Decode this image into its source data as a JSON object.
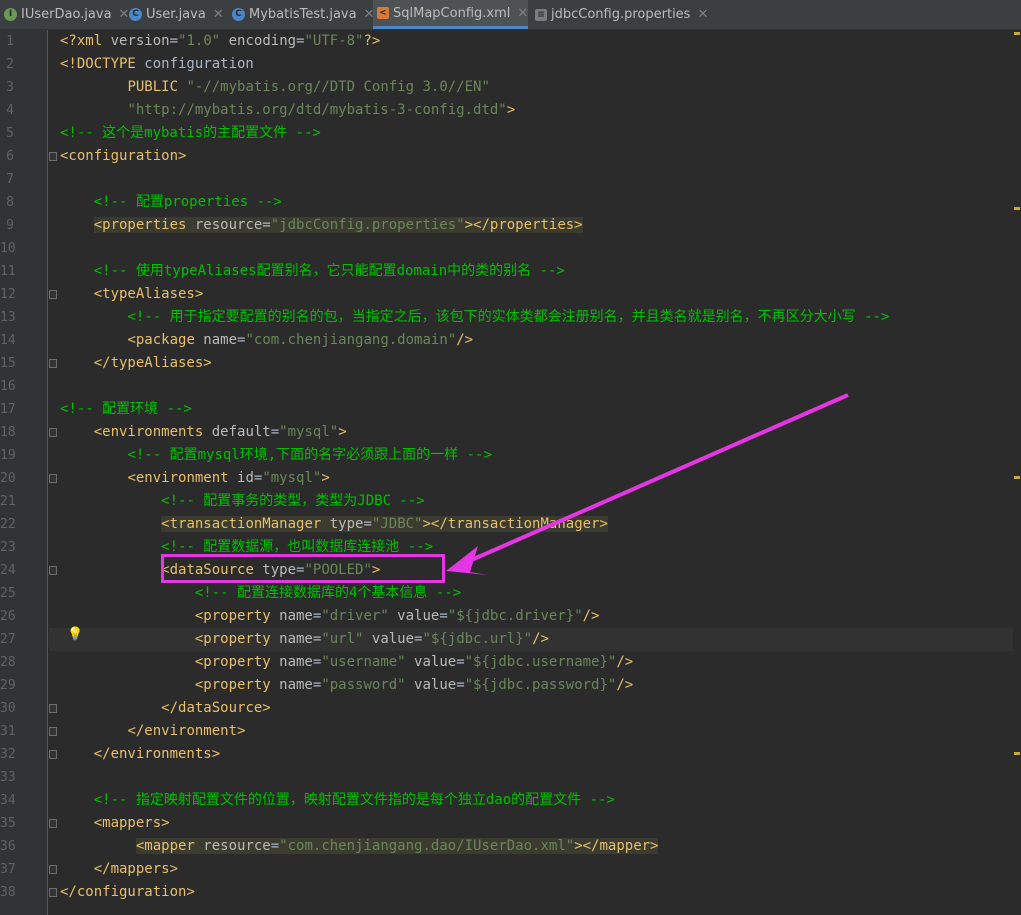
{
  "tabs": [
    {
      "icon": "interface-icon",
      "label": "IUserDao.java",
      "active": false
    },
    {
      "icon": "class-icon",
      "label": "User.java",
      "active": false
    },
    {
      "icon": "class-icon",
      "label": "MybatisTest.java",
      "active": false
    },
    {
      "icon": "xml-file-icon",
      "label": "SqlMapConfig.xml",
      "active": true
    },
    {
      "icon": "properties-file-icon",
      "label": "jdbcConfig.properties",
      "active": false
    }
  ],
  "lines": [
    {
      "n": "1",
      "tokens": [
        [
          "t",
          "<?xml"
        ],
        [
          "an",
          " version"
        ],
        [
          "df",
          "="
        ],
        [
          "av",
          "\"1.0\""
        ],
        [
          "an",
          " encoding"
        ],
        [
          "df",
          "="
        ],
        [
          "av",
          "\"UTF-8\""
        ],
        [
          "t",
          "?>"
        ]
      ]
    },
    {
      "n": "2",
      "tokens": [
        [
          "t",
          "<!DOCTYPE"
        ],
        [
          "df",
          " configuration"
        ]
      ]
    },
    {
      "n": "3",
      "tokens": [
        [
          "df",
          "        "
        ],
        [
          "t",
          "PUBLIC "
        ],
        [
          "av",
          "\"-//mybatis.org//DTD Config 3.0//EN\""
        ]
      ]
    },
    {
      "n": "4",
      "tokens": [
        [
          "df",
          "        "
        ],
        [
          "av",
          "\"http://mybatis.org/dtd/mybatis-3-config.dtd\""
        ],
        [
          "t",
          ">"
        ]
      ]
    },
    {
      "n": "5",
      "tokens": [
        [
          "cm",
          "<!-- 这个是mybatis的主配置文件 -->"
        ]
      ]
    },
    {
      "n": "6",
      "tokens": [
        [
          "t",
          "<configuration>"
        ]
      ]
    },
    {
      "n": "7",
      "tokens": []
    },
    {
      "n": "8",
      "tokens": [
        [
          "df",
          "    "
        ],
        [
          "cm",
          "<!-- 配置properties -->"
        ]
      ]
    },
    {
      "n": "9",
      "tokens": [
        [
          "df",
          "    "
        ],
        [
          "t hl",
          "<properties"
        ],
        [
          "an hl",
          " resource"
        ],
        [
          "df hl",
          "="
        ],
        [
          "av hl",
          "\"jdbcConfig.properties\""
        ],
        [
          "t hl",
          "></properties>"
        ]
      ]
    },
    {
      "n": "10",
      "tokens": []
    },
    {
      "n": "11",
      "tokens": [
        [
          "df",
          "    "
        ],
        [
          "cm",
          "<!-- 使用typeAliases配置别名，它只能配置domain中的类的别名 -->"
        ]
      ]
    },
    {
      "n": "12",
      "tokens": [
        [
          "df",
          "    "
        ],
        [
          "t",
          "<typeAliases>"
        ]
      ]
    },
    {
      "n": "13",
      "tokens": [
        [
          "df",
          "        "
        ],
        [
          "cm",
          "<!-- 用于指定要配置的别名的包，当指定之后，该包下的实体类都会注册别名，并且类名就是别名，不再区分大小写 -->"
        ]
      ]
    },
    {
      "n": "14",
      "tokens": [
        [
          "df",
          "        "
        ],
        [
          "t",
          "<package"
        ],
        [
          "an",
          " name"
        ],
        [
          "df",
          "="
        ],
        [
          "av",
          "\"com.chenjiangang.domain\""
        ],
        [
          "t",
          "/>"
        ]
      ]
    },
    {
      "n": "15",
      "tokens": [
        [
          "df",
          "    "
        ],
        [
          "t",
          "</typeAliases>"
        ]
      ]
    },
    {
      "n": "16",
      "tokens": []
    },
    {
      "n": "17",
      "tokens": [
        [
          "cm",
          "<!-- 配置环境 -->"
        ]
      ]
    },
    {
      "n": "18",
      "tokens": [
        [
          "df",
          "    "
        ],
        [
          "t",
          "<environments"
        ],
        [
          "an",
          " default"
        ],
        [
          "df",
          "="
        ],
        [
          "av",
          "\"mysql\""
        ],
        [
          "t",
          ">"
        ]
      ]
    },
    {
      "n": "19",
      "tokens": [
        [
          "df",
          "        "
        ],
        [
          "cm",
          "<!-- 配置mysql环境,下面的名字必须跟上面的一样 -->"
        ]
      ]
    },
    {
      "n": "20",
      "tokens": [
        [
          "df",
          "        "
        ],
        [
          "t",
          "<environment"
        ],
        [
          "an",
          " id"
        ],
        [
          "df",
          "="
        ],
        [
          "av",
          "\"mysql\""
        ],
        [
          "t",
          ">"
        ]
      ]
    },
    {
      "n": "21",
      "tokens": [
        [
          "df",
          "            "
        ],
        [
          "cm",
          "<!-- 配置事务的类型，类型为JDBC -->"
        ]
      ]
    },
    {
      "n": "22",
      "tokens": [
        [
          "df",
          "            "
        ],
        [
          "t hl",
          "<transactionManager"
        ],
        [
          "an hl",
          " type"
        ],
        [
          "df hl",
          "="
        ],
        [
          "av hl",
          "\"JDBC\""
        ],
        [
          "t hl",
          "></transactionManager>"
        ]
      ]
    },
    {
      "n": "23",
      "tokens": [
        [
          "df",
          "            "
        ],
        [
          "cm",
          "<!-- 配置数据源，也叫数据库连接池 -->"
        ]
      ]
    },
    {
      "n": "24",
      "tokens": [
        [
          "df",
          "            "
        ],
        [
          "t",
          "<dataSource"
        ],
        [
          "an",
          " type"
        ],
        [
          "df",
          "="
        ],
        [
          "av",
          "\"POOLED\""
        ],
        [
          "t",
          ">"
        ]
      ]
    },
    {
      "n": "25",
      "tokens": [
        [
          "df",
          "                "
        ],
        [
          "cm",
          "<!-- 配置连接数据库的4个基本信息 -->"
        ]
      ]
    },
    {
      "n": "26",
      "tokens": [
        [
          "df",
          "                "
        ],
        [
          "t",
          "<property"
        ],
        [
          "an",
          " name"
        ],
        [
          "df",
          "="
        ],
        [
          "av",
          "\"driver\""
        ],
        [
          "an",
          " value"
        ],
        [
          "df",
          "="
        ],
        [
          "av",
          "\"${jdbc.driver}\""
        ],
        [
          "t",
          "/>"
        ]
      ]
    },
    {
      "n": "27",
      "tokens": [
        [
          "df",
          "                "
        ],
        [
          "t",
          "<property"
        ],
        [
          "an",
          " name"
        ],
        [
          "df",
          "="
        ],
        [
          "av",
          "\"url\""
        ],
        [
          "an",
          " value"
        ],
        [
          "df",
          "="
        ],
        [
          "av",
          "\"${jdbc.url}\""
        ],
        [
          "t",
          "/>"
        ]
      ]
    },
    {
      "n": "28",
      "tokens": [
        [
          "df",
          "                "
        ],
        [
          "t",
          "<property"
        ],
        [
          "an",
          " name"
        ],
        [
          "df",
          "="
        ],
        [
          "av",
          "\"username\""
        ],
        [
          "an",
          " value"
        ],
        [
          "df",
          "="
        ],
        [
          "av",
          "\"${jdbc.username}\""
        ],
        [
          "t",
          "/>"
        ]
      ]
    },
    {
      "n": "29",
      "tokens": [
        [
          "df",
          "                "
        ],
        [
          "t",
          "<property"
        ],
        [
          "an",
          " name"
        ],
        [
          "df",
          "="
        ],
        [
          "av",
          "\"password\""
        ],
        [
          "an",
          " value"
        ],
        [
          "df",
          "="
        ],
        [
          "av",
          "\"${jdbc.password}\""
        ],
        [
          "t",
          "/>"
        ]
      ]
    },
    {
      "n": "30",
      "tokens": [
        [
          "df",
          "            "
        ],
        [
          "t",
          "</dataSource>"
        ]
      ]
    },
    {
      "n": "31",
      "tokens": [
        [
          "df",
          "        "
        ],
        [
          "t",
          "</environment>"
        ]
      ]
    },
    {
      "n": "32",
      "tokens": [
        [
          "df",
          "    "
        ],
        [
          "t",
          "</environments>"
        ]
      ]
    },
    {
      "n": "33",
      "tokens": []
    },
    {
      "n": "34",
      "tokens": [
        [
          "df",
          "    "
        ],
        [
          "cm",
          "<!-- 指定映射配置文件的位置，映射配置文件指的是每个独立dao的配置文件 -->"
        ]
      ]
    },
    {
      "n": "35",
      "tokens": [
        [
          "df",
          "    "
        ],
        [
          "t",
          "<mappers>"
        ]
      ]
    },
    {
      "n": "36",
      "tokens": [
        [
          "df",
          "         "
        ],
        [
          "t hl",
          "<mapper"
        ],
        [
          "an hl",
          " resource"
        ],
        [
          "df hl",
          "="
        ],
        [
          "av hl",
          "\"com.chenjiangang.dao/IUserDao.xml\""
        ],
        [
          "t hl",
          "></mapper>"
        ]
      ]
    },
    {
      "n": "37",
      "tokens": [
        [
          "df",
          "    "
        ],
        [
          "t",
          "</mappers>"
        ]
      ]
    },
    {
      "n": "38",
      "tokens": [
        [
          "t",
          "</configuration>"
        ]
      ]
    }
  ],
  "current_line": "27",
  "colors": {
    "tag": "#e8bf6a",
    "attr_name": "#bababa",
    "attr_value": "#6a8759",
    "comment": "#00c000",
    "annotation": "#e535e5"
  }
}
